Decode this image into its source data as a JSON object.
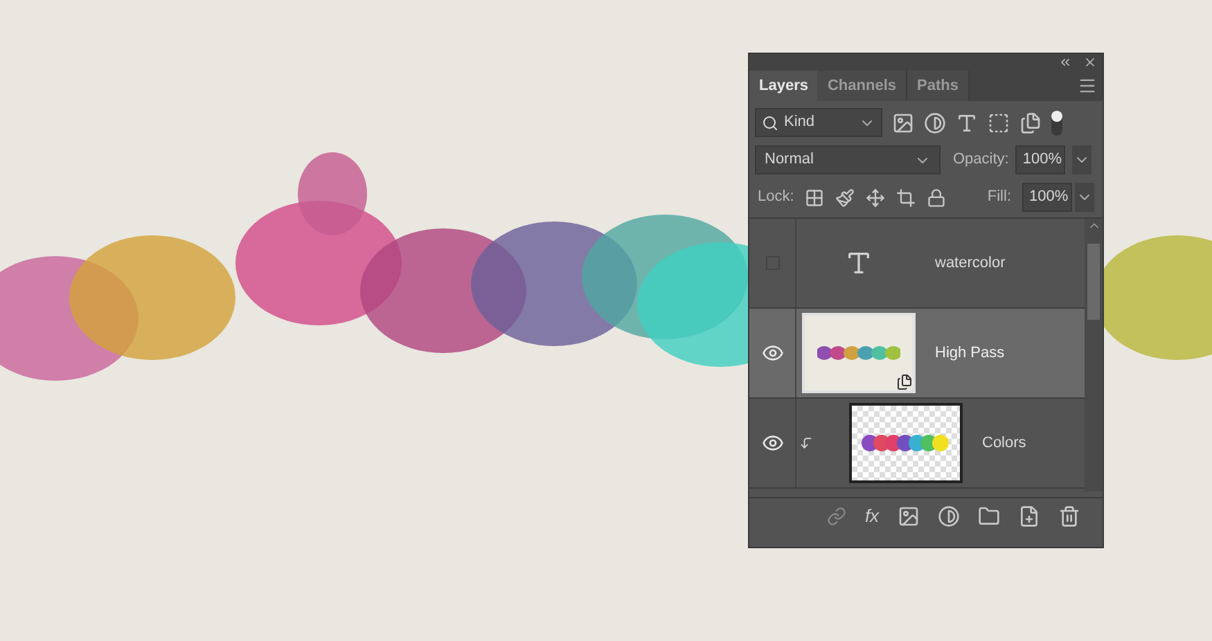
{
  "panel": {
    "tabs": [
      {
        "label": "Layers",
        "selected": true
      },
      {
        "label": "Channels",
        "selected": false
      },
      {
        "label": "Paths",
        "selected": false
      }
    ],
    "filter": {
      "value": "Kind"
    },
    "blend_mode": {
      "value": "Normal"
    },
    "opacity": {
      "label": "Opacity:",
      "value": "100%"
    },
    "lock_label": "Lock:",
    "fill": {
      "label": "Fill:",
      "value": "100%"
    },
    "layers": [
      {
        "kind": "text",
        "name": "watercolor",
        "visible": false,
        "selected": false,
        "clipped": false
      },
      {
        "kind": "smart",
        "name": "High Pass",
        "visible": true,
        "selected": true,
        "clipped": false
      },
      {
        "kind": "pixel",
        "name": "Colors",
        "visible": true,
        "selected": false,
        "clipped": true
      }
    ],
    "fx_label": "fx"
  }
}
